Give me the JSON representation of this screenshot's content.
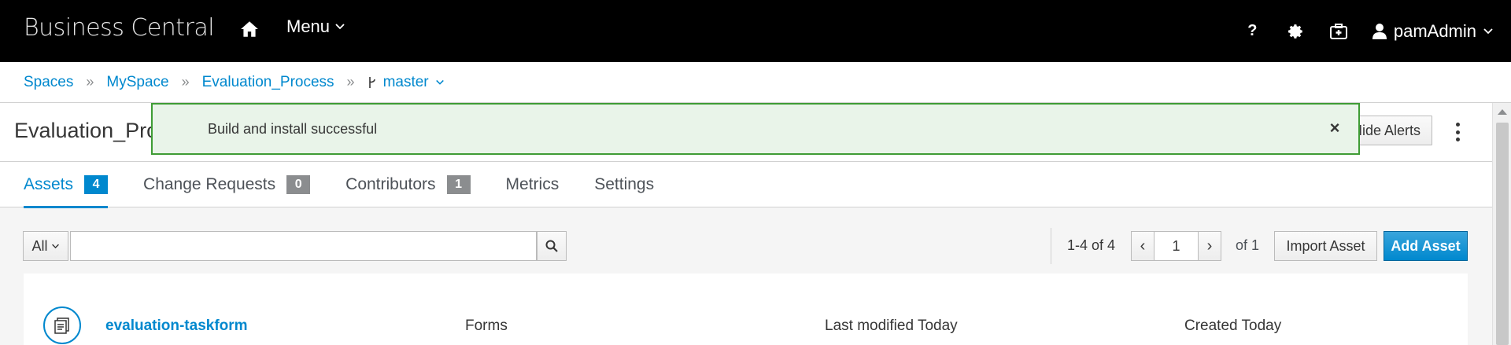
{
  "navbar": {
    "brand": "Business Central",
    "menu_label": "Menu",
    "user_name": "pamAdmin"
  },
  "breadcrumb": {
    "items": [
      "Spaces",
      "MySpace",
      "Evaluation_Process"
    ],
    "branch": "master"
  },
  "project": {
    "title": "Evaluation_Process",
    "hide_alerts_label": "Hide Alerts"
  },
  "alert": {
    "message": "Build and install successful"
  },
  "tabs": [
    {
      "label": "Assets",
      "count": "4"
    },
    {
      "label": "Change Requests",
      "count": "0"
    },
    {
      "label": "Contributors",
      "count": "1"
    },
    {
      "label": "Metrics"
    },
    {
      "label": "Settings"
    }
  ],
  "toolbar": {
    "filter_value": "All",
    "search_value": "",
    "page_range": "1-4 of 4",
    "page_number": "1",
    "page_of": "of 1",
    "import_label": "Import Asset",
    "add_label": "Add Asset"
  },
  "assets": [
    {
      "name": "evaluation-taskform",
      "type": "Forms",
      "modified": "Last modified Today",
      "created": "Created Today"
    }
  ],
  "colors": {
    "accent": "#0088ce",
    "success_border": "#3f9c35",
    "success_bg": "#e9f4e9",
    "navbar_bg": "#000000"
  }
}
